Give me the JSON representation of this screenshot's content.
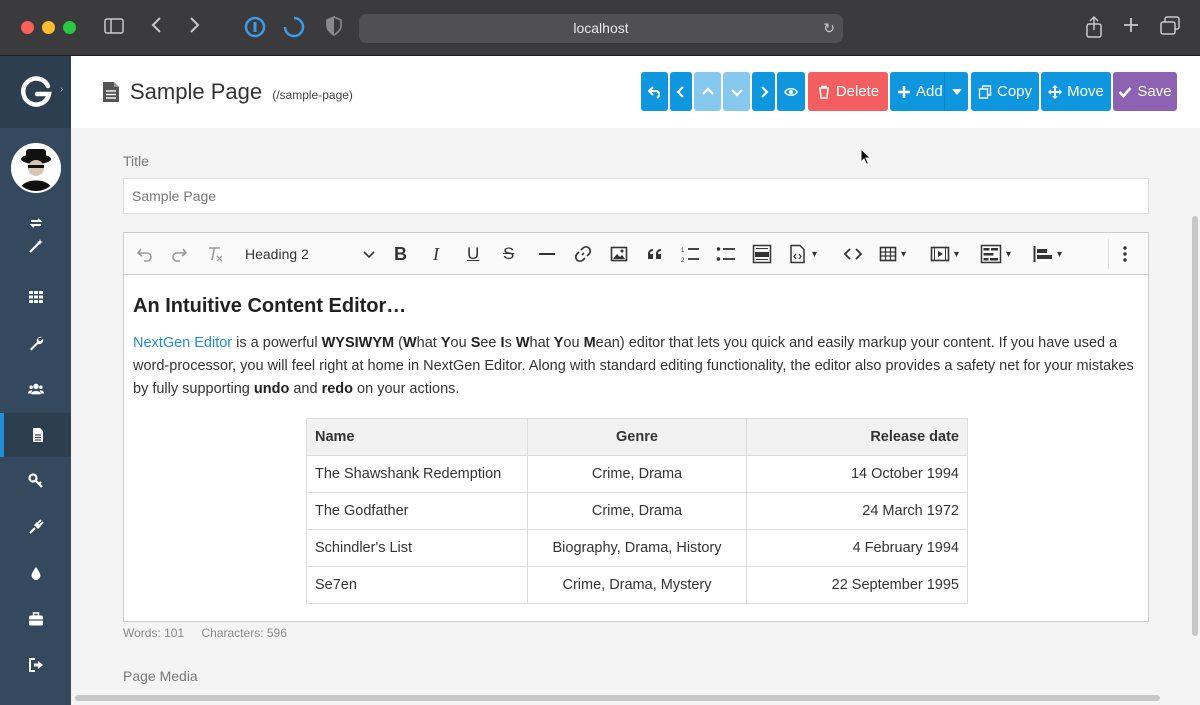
{
  "browser": {
    "url": "localhost"
  },
  "colors": {
    "sidebar": "#34495e",
    "accent_blue": "#0e97de",
    "danger": "#f35f61",
    "save": "#8e62b3",
    "link": "#1f8fd3"
  },
  "sidebar": {
    "items": [
      {
        "icon": "magic-wand-icon"
      },
      {
        "icon": "dashboard-grid-icon"
      },
      {
        "icon": "wrench-icon"
      },
      {
        "icon": "users-icon"
      },
      {
        "icon": "page-icon",
        "active": true
      },
      {
        "icon": "key-icon"
      },
      {
        "icon": "plug-icon"
      },
      {
        "icon": "droplet-icon"
      },
      {
        "icon": "briefcase-icon"
      },
      {
        "icon": "logout-icon"
      }
    ]
  },
  "header": {
    "title": "Sample Page",
    "route": "(/sample-page)",
    "buttons": {
      "delete": "Delete",
      "add": "Add",
      "copy": "Copy",
      "move": "Move",
      "save": "Save"
    }
  },
  "form": {
    "title_label": "Title",
    "title_value": "Sample Page",
    "media_label": "Page Media"
  },
  "editor": {
    "heading_select": "Heading 2",
    "heading": "An Intuitive Content Editor…",
    "p_link": "NextGen Editor",
    "p1": " is a powerful ",
    "p_bold1": "WYSIWYM",
    "p2": " (",
    "w1": "W",
    "w1r": "hat ",
    "w2": "Y",
    "w2r": "ou ",
    "w3": "S",
    "w3r": "ee ",
    "w4": "I",
    "w4r": "s ",
    "w5": "W",
    "w5r": "hat ",
    "w6": "Y",
    "w6r": "ou ",
    "w7": "M",
    "w7r": "ean",
    "p3": ") editor that lets you quick and easily markup your content. If you have used a word-processor, you will feel right at home in NextGen Editor. Along with standard editing functionality, the editor also provides a safety net for your mistakes by fully supporting ",
    "p_undo": "undo",
    "p4": " and ",
    "p_redo": "redo",
    "p5": " on your actions.",
    "table": {
      "headers": [
        "Name",
        "Genre",
        "Release date"
      ],
      "rows": [
        [
          "The Shawshank Redemption",
          "Crime, Drama",
          "14 October 1994"
        ],
        [
          "The Godfather",
          "Crime, Drama",
          "24 March 1972"
        ],
        [
          "Schindler's List",
          "Biography, Drama, History",
          "4 February 1994"
        ],
        [
          "Se7en",
          "Crime, Drama, Mystery",
          "22 September 1995"
        ]
      ]
    },
    "words": "Words: 101",
    "characters": "Characters: 596"
  }
}
